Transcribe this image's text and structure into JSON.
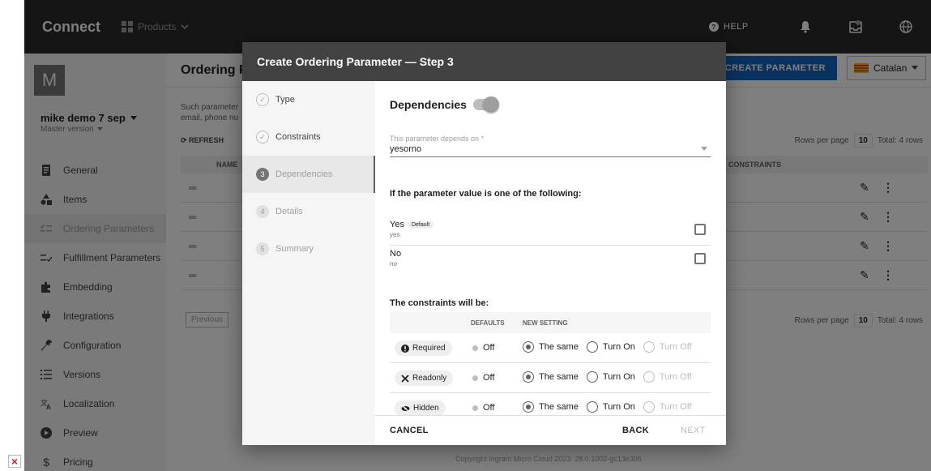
{
  "app": {
    "brand": "Connect",
    "products_label": "Products",
    "help_label": "HELP"
  },
  "sidebar": {
    "avatar_letter": "M",
    "account_name": "mike demo 7 sep",
    "account_sub": "Master version",
    "items": [
      {
        "label": "General",
        "icon": "document-icon"
      },
      {
        "label": "Items",
        "icon": "items-icon"
      },
      {
        "label": "Ordering Parameters",
        "icon": "checklist-icon",
        "active": true
      },
      {
        "label": "Fulfillment Parameters",
        "icon": "checklist-icon"
      },
      {
        "label": "Embedding",
        "icon": "puzzle-icon"
      },
      {
        "label": "Integrations",
        "icon": "plug-icon"
      },
      {
        "label": "Configuration",
        "icon": "wrench-icon"
      },
      {
        "label": "Versions",
        "icon": "list-icon"
      },
      {
        "label": "Localization",
        "icon": "translate-icon"
      },
      {
        "label": "Preview",
        "icon": "play-icon"
      },
      {
        "label": "Pricing",
        "icon": "dollar-icon"
      }
    ]
  },
  "main": {
    "title": "Ordering Pa",
    "create_button": "CREATE PARAMETER",
    "language": "Catalan",
    "description": "Such parameter email, phone nu",
    "refresh": "REFRESH",
    "columns": {
      "name": "NAME",
      "constraints": "CONSTRAINTS"
    },
    "rows_per_page_label": "Rows per page",
    "rows_per_page": "10",
    "total": "Total: 4 rows",
    "previous": "Previous",
    "footer": "Copyright Ingram Micro Cloud 2023. 28.0.1002-gc13e305"
  },
  "modal": {
    "title": "Create Ordering Parameter — Step 3",
    "steps": [
      {
        "num": "✓",
        "label": "Type",
        "state": "done"
      },
      {
        "num": "✓",
        "label": "Constraints",
        "state": "done"
      },
      {
        "num": "3",
        "label": "Dependencies",
        "state": "active"
      },
      {
        "num": "4",
        "label": "Details",
        "state": "pending"
      },
      {
        "num": "5",
        "label": "Summary",
        "state": "pending"
      }
    ],
    "dependencies_title": "Dependencies",
    "depends_on_label": "This parameter depends on *",
    "depends_on_value": "yesorno",
    "condition_heading": "If the parameter value is one of the following:",
    "options": [
      {
        "label": "Yes",
        "value": "yes",
        "badge": "Default"
      },
      {
        "label": "No",
        "value": "no",
        "badge": ""
      }
    ],
    "constraints_heading": "The constraints will be:",
    "table_headers": {
      "defaults": "DEFAULTS",
      "new_setting": "NEW SETTING"
    },
    "constraints": [
      {
        "name": "Required",
        "icon": "alert-circle-icon",
        "default": "Off"
      },
      {
        "name": "Readonly",
        "icon": "no-edit-icon",
        "default": "Off"
      },
      {
        "name": "Hidden",
        "icon": "eye-off-icon",
        "default": "Off"
      }
    ],
    "radio_labels": {
      "same": "The same",
      "on": "Turn On",
      "off": "Turn Off"
    },
    "buttons": {
      "cancel": "CANCEL",
      "back": "BACK",
      "next": "NEXT"
    }
  }
}
